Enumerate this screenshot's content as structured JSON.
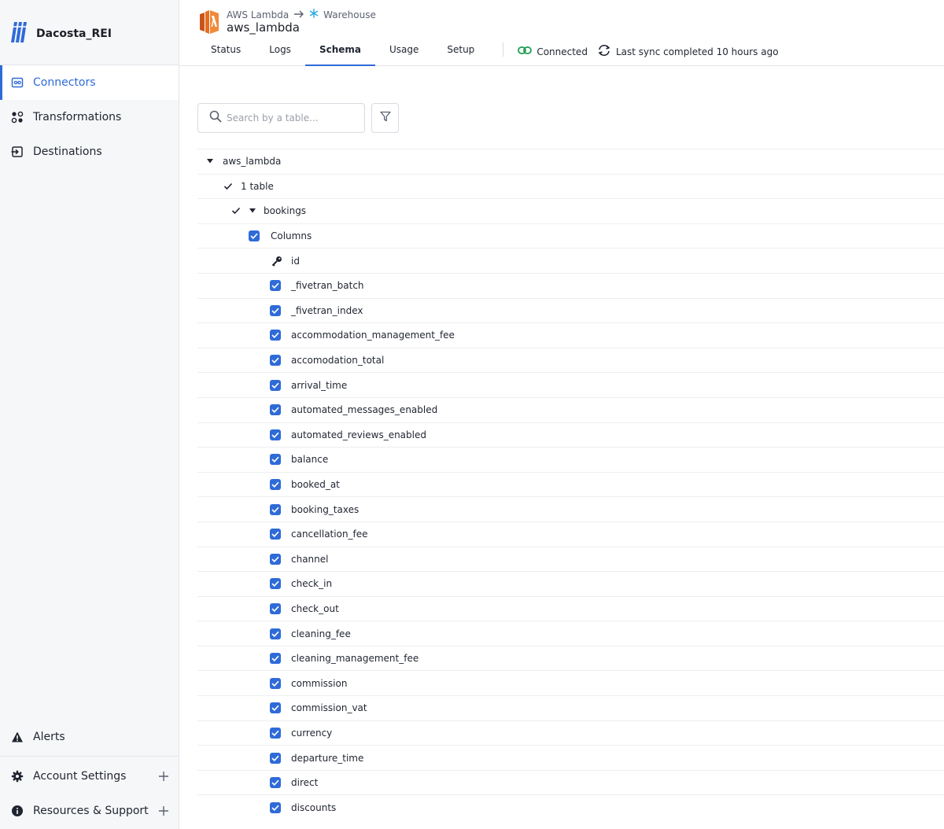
{
  "sidebar": {
    "brand": "Dacosta_REI",
    "nav": [
      {
        "label": "Connectors",
        "icon": "connectors-icon",
        "active": true
      },
      {
        "label": "Transformations",
        "icon": "transformations-icon",
        "active": false
      },
      {
        "label": "Destinations",
        "icon": "destinations-icon",
        "active": false
      }
    ],
    "bottom": [
      {
        "label": "Alerts",
        "icon": "warning-icon"
      },
      {
        "label": "Account Settings",
        "icon": "gear-icon"
      },
      {
        "label": "Resources & Support",
        "icon": "info-icon"
      }
    ]
  },
  "header": {
    "source": "AWS Lambda",
    "destination": "Warehouse",
    "connector_name": "aws_lambda",
    "tabs": [
      "Status",
      "Logs",
      "Schema",
      "Usage",
      "Setup"
    ],
    "active_tab": "Schema",
    "connection_status": "Connected",
    "sync_status": "Last sync completed 10 hours ago"
  },
  "search": {
    "placeholder": "Search by a table..."
  },
  "schema": {
    "root": "aws_lambda",
    "table_count": "1 table",
    "table": "bookings",
    "columns_label": "Columns",
    "primary_key": "id",
    "columns": [
      "_fivetran_batch",
      "_fivetran_index",
      "accommodation_management_fee",
      "accomodation_total",
      "arrival_time",
      "automated_messages_enabled",
      "automated_reviews_enabled",
      "balance",
      "booked_at",
      "booking_taxes",
      "cancellation_fee",
      "channel",
      "check_in",
      "check_out",
      "cleaning_fee",
      "cleaning_management_fee",
      "commission",
      "commission_vat",
      "currency",
      "departure_time",
      "direct",
      "discounts"
    ]
  },
  "colors": {
    "accent": "#2f6bd8",
    "connected": "#1e9e52",
    "lambda": "#e56e1f"
  }
}
